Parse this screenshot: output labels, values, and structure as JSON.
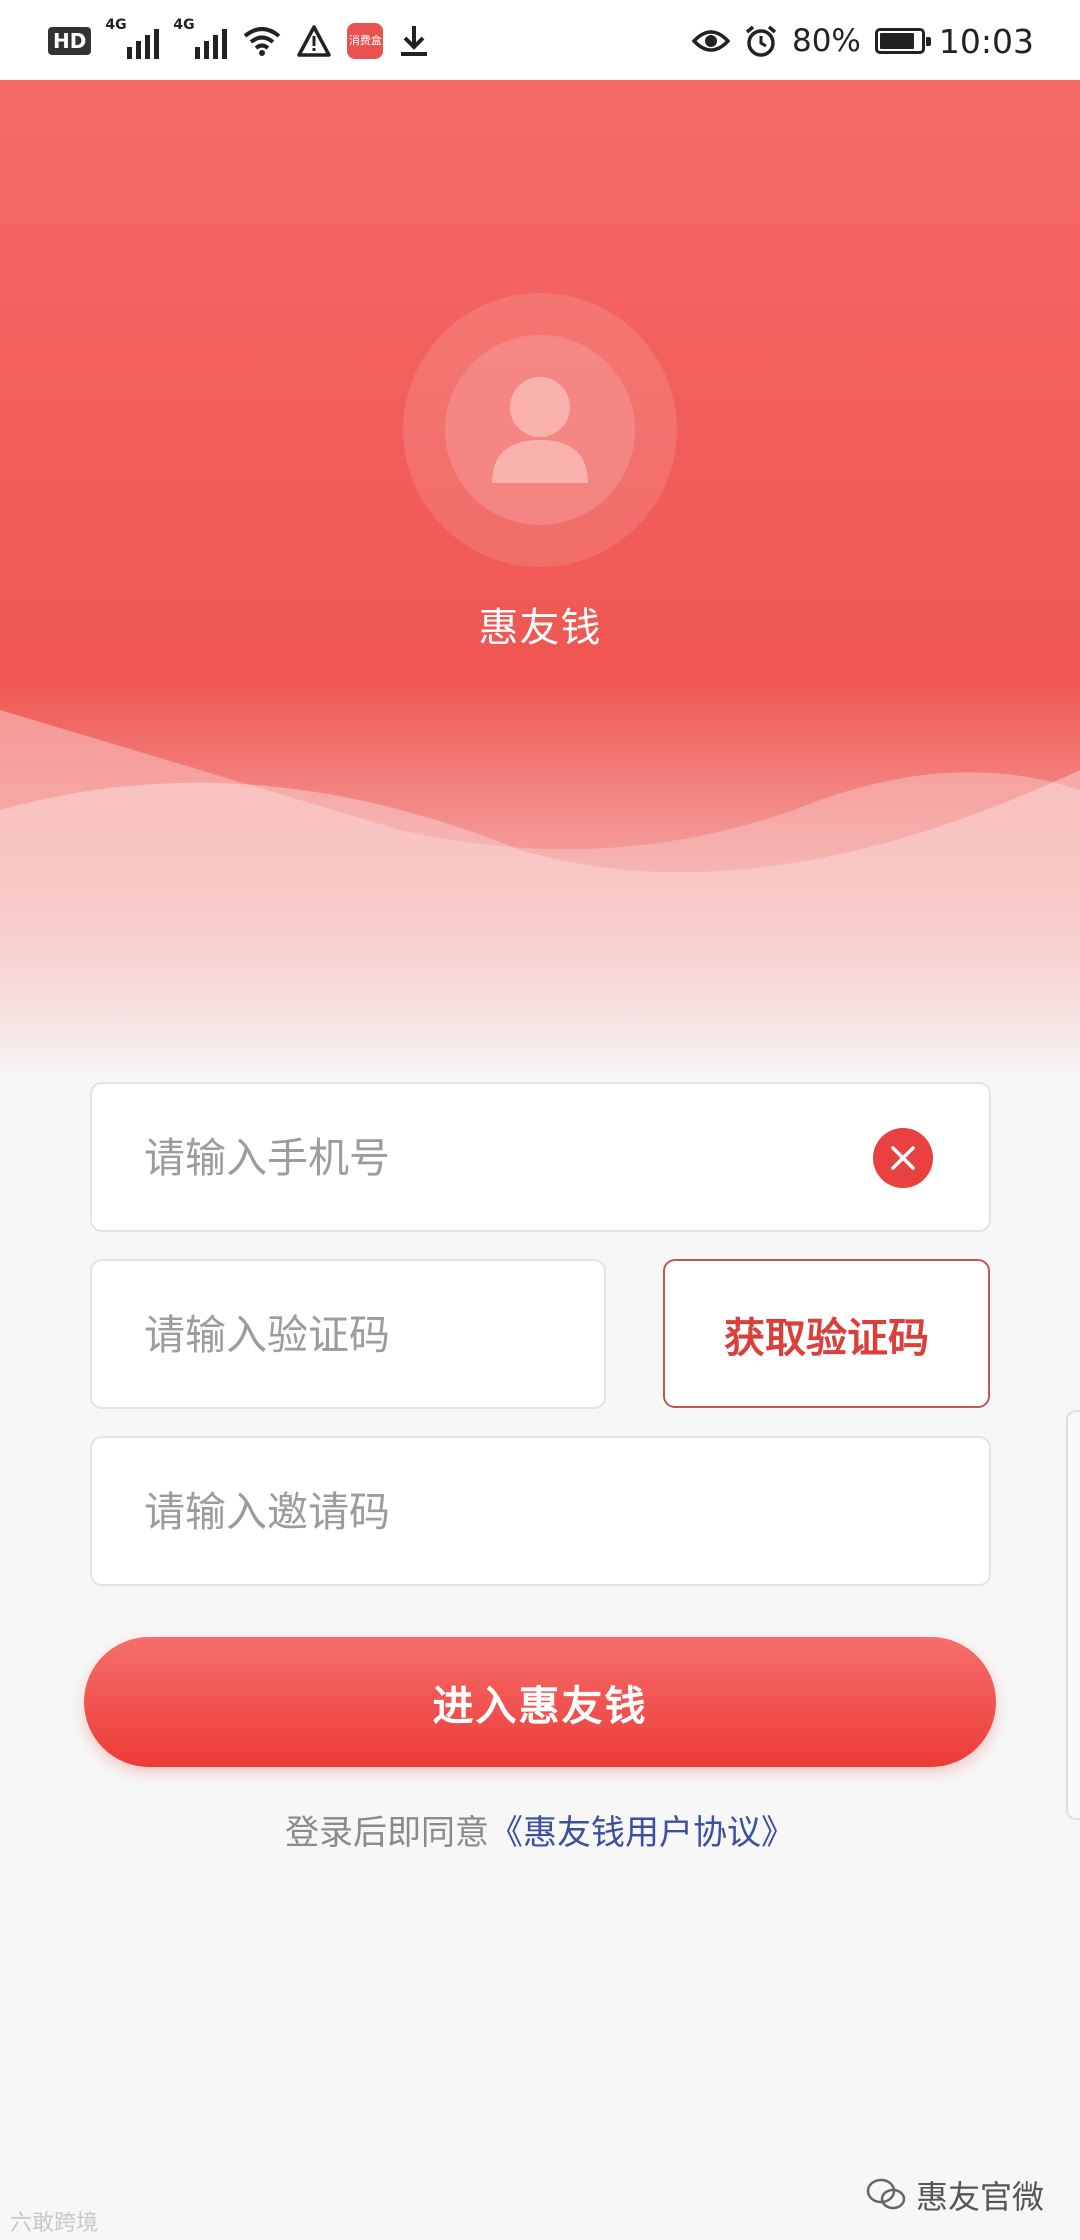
{
  "status_bar": {
    "hd": "HD",
    "net1": "4G",
    "net2": "4G",
    "battery_pct": "80%",
    "time": "10:03",
    "app_badge_text": "消费盒"
  },
  "header": {
    "title": "惠友钱",
    "gradient_top": "#f56a66",
    "gradient_bottom": "#f05652"
  },
  "form": {
    "phone_placeholder": "请输入手机号",
    "code_placeholder": "请输入验证码",
    "get_code_label": "获取验证码",
    "invite_placeholder": "请输入邀请码",
    "submit_label": "进入惠友钱",
    "agreement_prefix": "登录后即同意",
    "agreement_link": "《惠友钱用户协议》"
  },
  "watermarks": {
    "left": "六敢跨境",
    "right": "惠友官微"
  },
  "colors": {
    "accent": "#e8413f",
    "link": "#3b4fa0"
  }
}
